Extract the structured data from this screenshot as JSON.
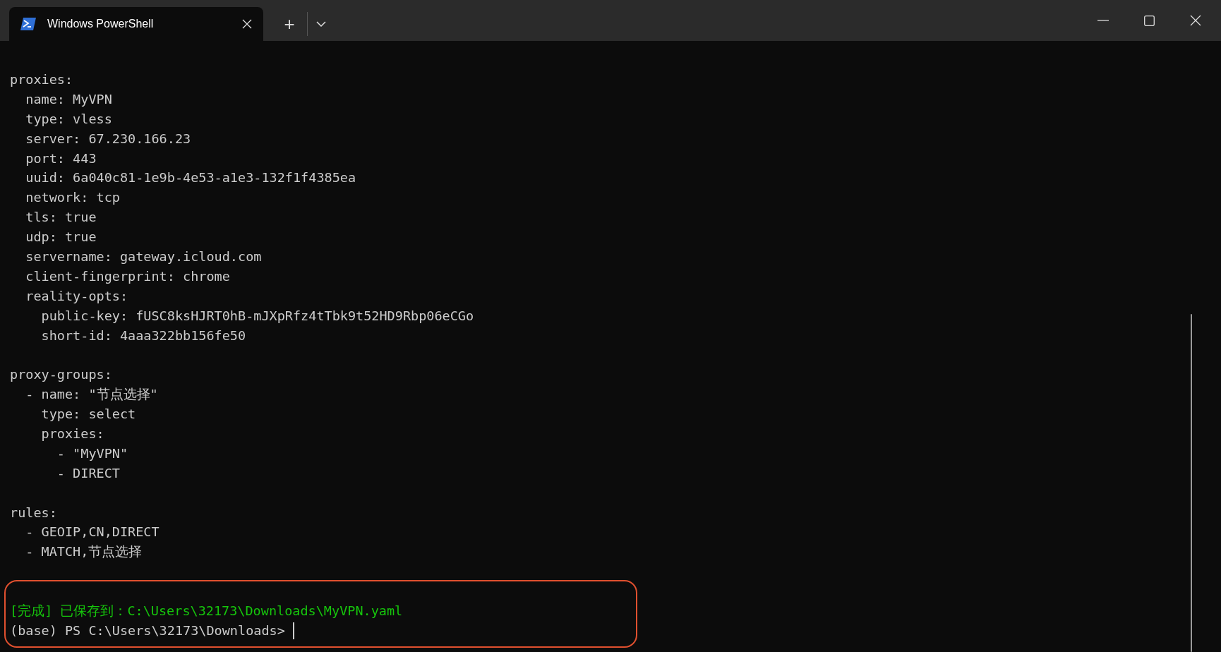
{
  "window": {
    "tab": {
      "title": "Windows PowerShell",
      "selected": true
    },
    "new_tab": "+"
  },
  "terminal": {
    "lines": [
      {
        "kind": "output",
        "text": "proxies:"
      },
      {
        "kind": "output",
        "text": "  name: MyVPN"
      },
      {
        "kind": "output",
        "text": "  type: vless"
      },
      {
        "kind": "output",
        "text": "  server: 67.230.166.23"
      },
      {
        "kind": "output",
        "text": "  port: 443"
      },
      {
        "kind": "output",
        "text": "  uuid: 6a040c81-1e9b-4e53-a1e3-132f1f4385ea"
      },
      {
        "kind": "output",
        "text": "  network: tcp"
      },
      {
        "kind": "output",
        "text": "  tls: true"
      },
      {
        "kind": "output",
        "text": "  udp: true"
      },
      {
        "kind": "output",
        "text": "  servername: gateway.icloud.com"
      },
      {
        "kind": "output",
        "text": "  client-fingerprint: chrome"
      },
      {
        "kind": "output",
        "text": "  reality-opts:"
      },
      {
        "kind": "output",
        "text": "    public-key: fUSC8ksHJRT0hB-mJXpRfz4tTbk9t52HD9Rbp06eCGo"
      },
      {
        "kind": "output",
        "text": "    short-id: 4aaa322bb156fe50"
      },
      {
        "kind": "blank"
      },
      {
        "kind": "output",
        "text": "proxy-groups:"
      },
      {
        "kind": "output",
        "text": "  - name: \"节点选择\""
      },
      {
        "kind": "output",
        "text": "    type: select"
      },
      {
        "kind": "output",
        "text": "    proxies:"
      },
      {
        "kind": "output",
        "text": "      - \"MyVPN\""
      },
      {
        "kind": "output",
        "text": "      - DIRECT"
      },
      {
        "kind": "blank"
      },
      {
        "kind": "output",
        "text": "rules:"
      },
      {
        "kind": "output",
        "text": "  - GEOIP,CN,DIRECT"
      },
      {
        "kind": "output",
        "text": "  - MATCH,节点选择"
      },
      {
        "kind": "blank"
      },
      {
        "kind": "blank"
      },
      {
        "kind": "success",
        "text": "[完成] 已保存到：C:\\Users\\32173\\Downloads\\MyVPN.yaml"
      },
      {
        "kind": "prompt",
        "text": "(base) PS C:\\Users\\32173\\Downloads> "
      }
    ]
  }
}
